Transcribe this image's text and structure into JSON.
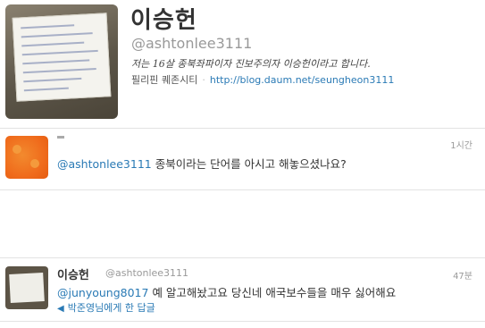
{
  "profile": {
    "name": "이승헌",
    "handle": "@ashtonlee3111",
    "bio": "저는 16살 종북좌파이자 진보주의자 이승헌이라고 합니다.",
    "location": "필리핀 퀘존시티",
    "url": "http://blog.daum.net/seungheon3111"
  },
  "tweets": [
    {
      "time": "1시간",
      "mention": "@ashtonlee3111",
      "text": " 종북이라는 단어를 아시고 해놓으셨나요?"
    },
    {
      "name": "이승헌",
      "handle": "@ashtonlee3111",
      "time": "47분",
      "mention": "@junyoung8017",
      "text": " 예 알고해놨고요 당신네 애국보수들을 매우 싫어해요",
      "reply_context": "박준영님에게 한 답글"
    }
  ],
  "colors": {
    "link": "#2a7ab5",
    "muted": "#999999",
    "text": "#333333"
  }
}
